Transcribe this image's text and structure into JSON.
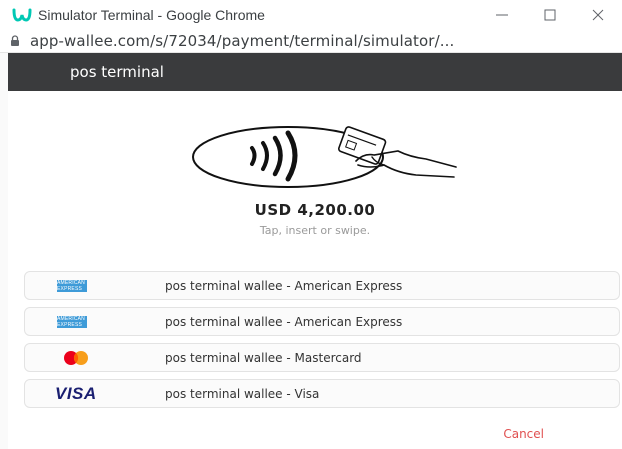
{
  "window": {
    "title": "Simulator Terminal - Google Chrome",
    "logo_icon": "wallee-logo-icon",
    "controls": [
      "minimize-icon",
      "maximize-icon",
      "close-icon"
    ]
  },
  "address_bar": {
    "url": "app-wallee.com/s/72034/payment/terminal/simulator/...",
    "icon": "lock-icon"
  },
  "header": {
    "title": "pos terminal"
  },
  "payment": {
    "amount": "USD 4,200.00",
    "instruction": "Tap, insert or swipe.",
    "illustration_icon": "contactless-tap-card-icon"
  },
  "methods": [
    {
      "label": "pos terminal wallee - American Express",
      "logo": "amex-logo"
    },
    {
      "label": "pos terminal wallee - American Express",
      "logo": "amex-logo"
    },
    {
      "label": "pos terminal wallee - Mastercard",
      "logo": "mastercard-logo"
    },
    {
      "label": "pos terminal wallee - Visa",
      "logo": "visa-logo",
      "logo_text": "VISA"
    }
  ],
  "actions": {
    "cancel_label": "Cancel"
  },
  "colors": {
    "header_bg": "#3a3b3d",
    "cancel": "#e05050",
    "amex": "#3e9bd8",
    "visa": "#1a1f71",
    "mastercard_red": "#eb001b",
    "mastercard_orange": "#f79e1b",
    "wallee_teal": "#00c8b4"
  }
}
